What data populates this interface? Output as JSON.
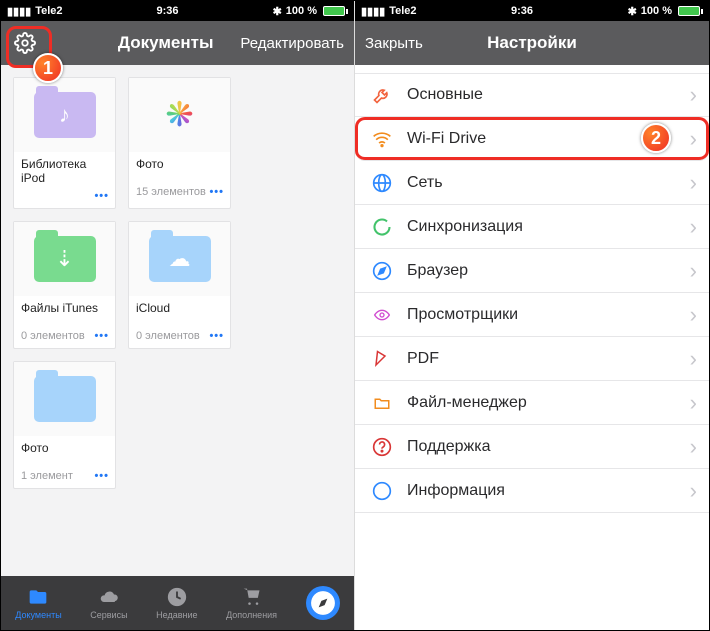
{
  "status": {
    "carrier": "Tele2",
    "time": "9:36",
    "battery_pct": "100 %",
    "bluetooth": "✱"
  },
  "left": {
    "nav_title": "Документы",
    "nav_edit": "Редактировать",
    "items": [
      {
        "title": "Библиотека iPod",
        "meta": "",
        "kind": "purple",
        "glyph": "♪"
      },
      {
        "title": "Фото",
        "meta": "15 элементов",
        "kind": "photos"
      },
      {
        "title": "Файлы iTunes",
        "meta": "0 элементов",
        "kind": "green",
        "glyph": "⇣"
      },
      {
        "title": "iCloud",
        "meta": "0 элементов",
        "kind": "blue",
        "glyph": "☁"
      },
      {
        "title": "Фото",
        "meta": "1 элемент",
        "kind": "blue",
        "glyph": ""
      }
    ],
    "tabs": [
      {
        "label": "Документы",
        "icon": "folder",
        "active": true
      },
      {
        "label": "Сервисы",
        "icon": "cloud",
        "active": false
      },
      {
        "label": "Недавние",
        "icon": "clock",
        "active": false
      },
      {
        "label": "Дополнения",
        "icon": "cart",
        "active": false
      },
      {
        "label": "",
        "icon": "compass",
        "active": false
      }
    ],
    "callout": "1"
  },
  "right": {
    "nav_close": "Закрыть",
    "nav_title": "Настройки",
    "rows": [
      {
        "label": "Основные",
        "icon": "wrench",
        "color": "#f2633e"
      },
      {
        "label": "Wi-Fi Drive",
        "icon": "wifi",
        "color": "#f28c1e",
        "highlight": true
      },
      {
        "label": "Сеть",
        "icon": "globe",
        "color": "#2e89ff"
      },
      {
        "label": "Синхронизация",
        "icon": "sync",
        "color": "#43c36b"
      },
      {
        "label": "Браузер",
        "icon": "compass",
        "color": "#2e89ff"
      },
      {
        "label": "Просмотрщики",
        "icon": "eye",
        "color": "#d04bd0"
      },
      {
        "label": "PDF",
        "icon": "pdf",
        "color": "#d93636"
      },
      {
        "label": "Файл-менеджер",
        "icon": "folder",
        "color": "#f28c1e"
      },
      {
        "label": "Поддержка",
        "icon": "help",
        "color": "#d93636"
      },
      {
        "label": "Информация",
        "icon": "info",
        "color": "#2e89ff"
      }
    ],
    "callout": "2"
  }
}
